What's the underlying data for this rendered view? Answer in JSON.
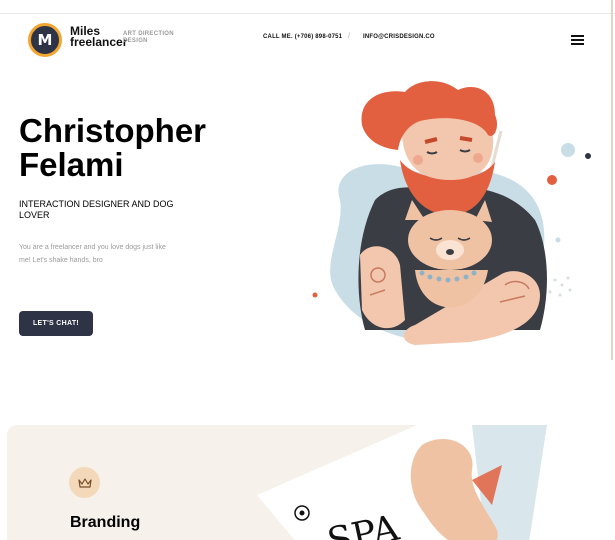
{
  "header": {
    "logo_letter": "M",
    "brand_line1": "Miles",
    "brand_line2": "freelancer",
    "tagline_line1": "ART DIRECTION",
    "tagline_line2": "DESIGN",
    "phone": "CALL ME. (+706) 898-0751",
    "separator": "/",
    "email": "INFO@CRISDESIGN.CO",
    "menu_icon": "hamburger-icon"
  },
  "hero": {
    "title": "Christopher Felami",
    "role": "INTERACTION DESIGNER AND DOG LOVER",
    "description": "You are a freelancer and you love dogs just like me! Let's shake hands, bro",
    "cta_label": "LET'S CHAT!",
    "illustration": "man-hugging-dog-illustration"
  },
  "services": {
    "card_title": "Branding",
    "card_icon": "crown-icon",
    "artwork_text": "SPA"
  },
  "colors": {
    "accent_dark": "#2f3346",
    "logo_ring": "#f2a531",
    "hair": "#e2603f",
    "blob": "#c9dde6",
    "card_bg": "#f6f1ea",
    "icon_bg": "#f3d9b9"
  }
}
